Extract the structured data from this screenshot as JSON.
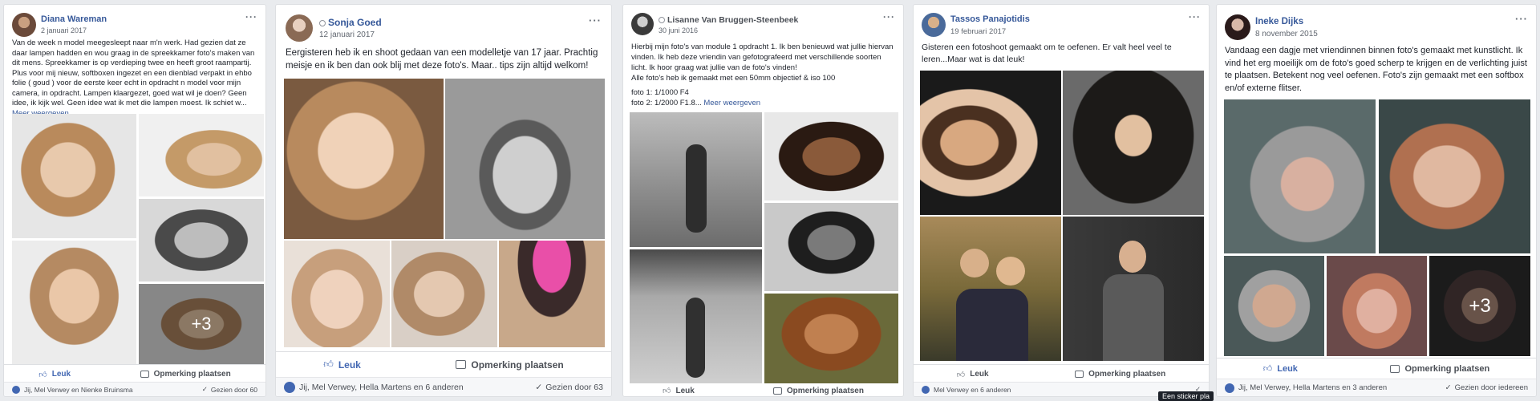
{
  "colors": {
    "page_bg": "#e9ebee",
    "link": "#365899",
    "like": "#4267b2"
  },
  "ui": {
    "like_label": "Leuk",
    "comment_label": "Opmerking plaatsen",
    "more_label": "Meer weergeven",
    "plus_icon": "thumbs-up-icon",
    "tooltip": "Een sticker pla"
  },
  "posts": [
    {
      "author": "Diana Wareman",
      "date": "2 januari 2017",
      "text": "Van de week n model meegesleept naar m'n werk. Had gezien dat ze daar lampen hadden en wou graag in de spreekkamer foto's maken van dit mens. Spreekkamer is op verdieping twee en heeft groot raampartij. Plus voor mij nieuw, softboxen ingezet en een dienblad verpakt in ehbo folie ( goud ) voor de eerste keer echt in opdracht n model voor mijn camera, in opdracht. Lampen klaargezet, goed wat wil je doen? Geen idee, ik kijk wel. Geen idee wat ik met die lampen moest. Ik schiet w...",
      "more_count": "+3",
      "reactions": "Jij, Mel Verwey en Nienke Bruinsma",
      "seen": "Gezien door 60"
    },
    {
      "author": "Sonja Goed",
      "date": "12 januari 2017",
      "text": "Eergisteren heb ik en shoot gedaan van een modelletje van 17 jaar. Prachtig meisje en ik ben dan ook blij met deze foto's. Maar.. tips zijn altijd welkom!",
      "reactions": "Jij, Mel Verwey, Hella Martens en 6 anderen",
      "seen": "Gezien door 63"
    },
    {
      "author": "Lisanne Van Bruggen-Steenbeek",
      "date": "30 juni 2016",
      "text": "Hierbij mijn foto's van module 1 opdracht 1. Ik ben benieuwd wat jullie hiervan vinden. Ik heb deze vriendin van gefotografeerd met verschillende soorten licht. Ik hoor graag wat jullie van de foto's vinden!",
      "text2": "Alle foto's heb ik gemaakt met een 50mm objectief & iso 100",
      "text3": "foto 1: 1/1000 F4",
      "text4": "foto 2: 1/2000 F1.8...",
      "reactions": "",
      "seen": ""
    },
    {
      "author": "Tassos Panajotidis",
      "date": "19 februari 2017",
      "text": "Gisteren een fotoshoot gemaakt om te oefenen. Er valt heel veel te leren...Maar wat is dat leuk!",
      "reactions": "Mel Verwey en 6 anderen",
      "seen": ""
    },
    {
      "author": "Ineke Dijks",
      "date": "8 november 2015",
      "text": "Vandaag een dagje met vriendinnen binnen foto's gemaakt met kunstlicht. Ik vind het erg moeilijk om de foto's goed scherp te krijgen en de verlichting juist te plaatsen. Betekent nog veel oefenen. Foto's zijn gemaakt met een softbox en/of externe flitser.",
      "more_count": "+3",
      "reactions": "Jij, Mel Verwey, Hella Martens en 3 anderen",
      "seen": "Gezien door iedereen"
    }
  ]
}
